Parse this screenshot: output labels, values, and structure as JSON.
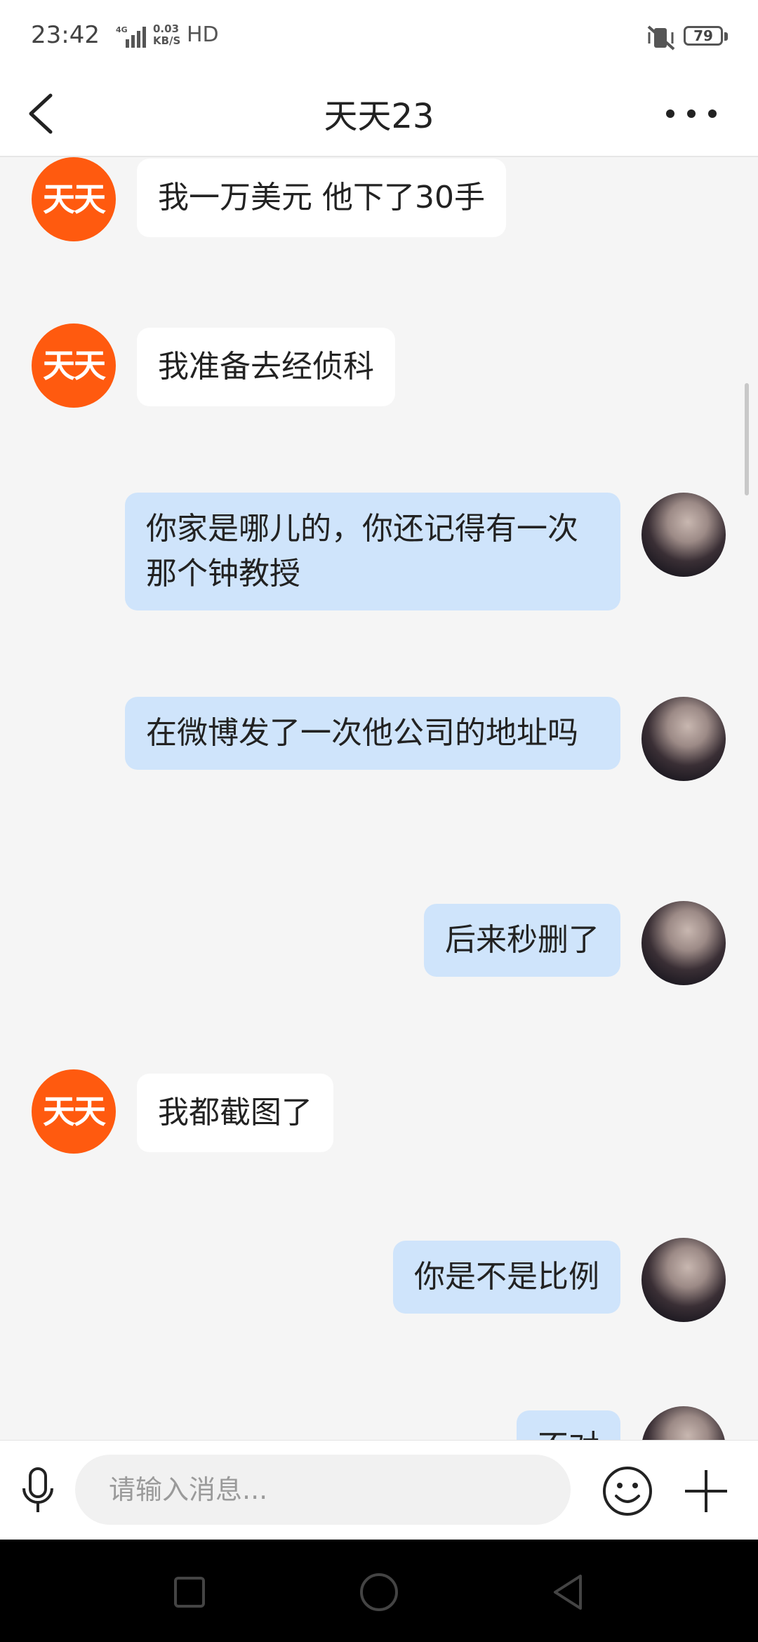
{
  "status_bar": {
    "time": "23:42",
    "network": "4G",
    "speed_value": "0.03",
    "speed_unit": "KB/S",
    "hd": "HD",
    "battery": "79"
  },
  "header": {
    "title": "天天23",
    "back_icon": "chevron-left-icon",
    "more_icon": "more-dots-icon"
  },
  "contact": {
    "avatar_text": "天天",
    "avatar_color": "#ff5a0f"
  },
  "messages": [
    {
      "side": "left",
      "text": "我一万美元 他下了30手"
    },
    {
      "side": "left",
      "text": "我准备去经侦科"
    },
    {
      "side": "right",
      "text": "你家是哪儿的，你还记得有一次那个钟教授"
    },
    {
      "side": "right",
      "text": "在微博发了一次他公司的地址吗"
    },
    {
      "side": "right",
      "text": "后来秒删了"
    },
    {
      "side": "left",
      "text": "我都截图了"
    },
    {
      "side": "right",
      "text": "你是不是比例"
    },
    {
      "side": "right",
      "text": "不对"
    }
  ],
  "input": {
    "placeholder": "请输入消息..."
  },
  "colors": {
    "sent_bubble": "#cfe4fb",
    "received_bubble": "#ffffff",
    "background": "#f5f5f5"
  }
}
